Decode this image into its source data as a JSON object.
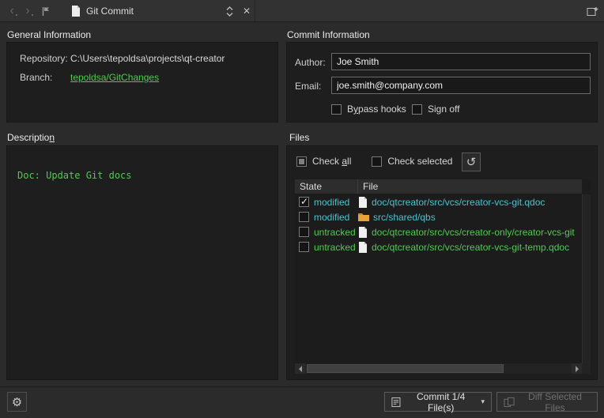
{
  "titlebar": {
    "title": "Git Commit"
  },
  "icons": {
    "back": "‹",
    "forward": "›",
    "close": "✕",
    "refresh": "↺",
    "gear": "⚙",
    "dropdown": "▾"
  },
  "general": {
    "header": "General Information",
    "repository_label": "Repository:",
    "repository_value": "C:\\Users\\tepoldsa\\projects\\qt-creator",
    "branch_label": "Branch:",
    "branch_value": "tepoldsa/GitChanges"
  },
  "commit_info": {
    "header": "Commit Information",
    "author_label": "Author:",
    "author_value": "Joe Smith",
    "email_label": "Email:",
    "email_value": "joe.smith@company.com",
    "bypass_hooks": {
      "pre": "B",
      "mn": "y",
      "post": "pass hooks"
    },
    "bypass_hooks_state": false,
    "sign_off": "Sign off",
    "sign_off_state": false
  },
  "description": {
    "header": {
      "pre": "Descriptio",
      "mn": "n",
      "post": ""
    },
    "text": "Doc: Update Git docs"
  },
  "files": {
    "header": "Files",
    "check_all": {
      "pre": "Check ",
      "mn": "a",
      "post": "ll"
    },
    "check_all_state": "partial",
    "check_selected": "Check selected",
    "check_selected_state": false,
    "columns": [
      "State",
      "File"
    ],
    "rows": [
      {
        "checked": true,
        "state": "modified",
        "kind": "file",
        "file": "doc/qtcreator/src/vcs/creator-vcs-git.qdoc"
      },
      {
        "checked": false,
        "state": "modified",
        "kind": "folder",
        "file": "src/shared/qbs"
      },
      {
        "checked": false,
        "state": "untracked",
        "kind": "file",
        "file": "doc/qtcreator/src/vcs/creator-only/creator-vcs-git"
      },
      {
        "checked": false,
        "state": "untracked",
        "kind": "file",
        "file": "doc/qtcreator/src/vcs/creator-vcs-git-temp.qdoc"
      }
    ]
  },
  "footer": {
    "commit_label": "Commit 1/4 File(s)",
    "diff_label": "Diff Selected Files"
  },
  "colors": {
    "modified": "#4cc2cd",
    "untracked": "#52c952",
    "branch_link": "#52c952",
    "panel_bg": "#1e1e1e",
    "window_bg": "#2b2b2b"
  }
}
